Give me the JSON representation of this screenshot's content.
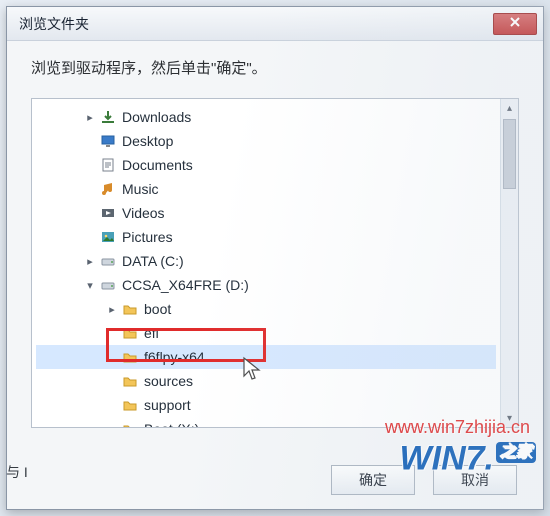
{
  "window": {
    "title": "浏览文件夹"
  },
  "instruction": "浏览到驱动程序，然后单击\"确定\"。",
  "tree": {
    "items": [
      {
        "level": 1,
        "expander": "▸",
        "icon": "download",
        "label": "Downloads"
      },
      {
        "level": 1,
        "expander": "",
        "icon": "desktop",
        "label": "Desktop"
      },
      {
        "level": 1,
        "expander": "",
        "icon": "document",
        "label": "Documents"
      },
      {
        "level": 1,
        "expander": "",
        "icon": "music",
        "label": "Music"
      },
      {
        "level": 1,
        "expander": "",
        "icon": "video",
        "label": "Videos"
      },
      {
        "level": 1,
        "expander": "",
        "icon": "picture",
        "label": "Pictures"
      },
      {
        "level": 1,
        "expander": "▸",
        "icon": "drive",
        "label": "DATA (C:)"
      },
      {
        "level": 1,
        "expander": "▾",
        "icon": "drive",
        "label": "CCSA_X64FRE (D:)"
      },
      {
        "level": 2,
        "expander": "▸",
        "icon": "folder",
        "label": "boot"
      },
      {
        "level": 2,
        "expander": "",
        "icon": "folder",
        "label": "efi"
      },
      {
        "level": 2,
        "expander": "",
        "icon": "folder",
        "label": "f6flpy-x64",
        "selected": true
      },
      {
        "level": 2,
        "expander": "",
        "icon": "folder",
        "label": "sources"
      },
      {
        "level": 2,
        "expander": "",
        "icon": "folder",
        "label": "support"
      },
      {
        "level": 2,
        "expander": "▸",
        "icon": "folder",
        "label": "Boot (X:)"
      }
    ]
  },
  "buttons": {
    "ok": "确定",
    "cancel": "取消"
  },
  "side_label": "与 I",
  "watermark": {
    "url": "www.win7zhijia.cn",
    "logo_a": "WIN",
    "logo_b": "7.",
    "logo_c": "之家"
  }
}
